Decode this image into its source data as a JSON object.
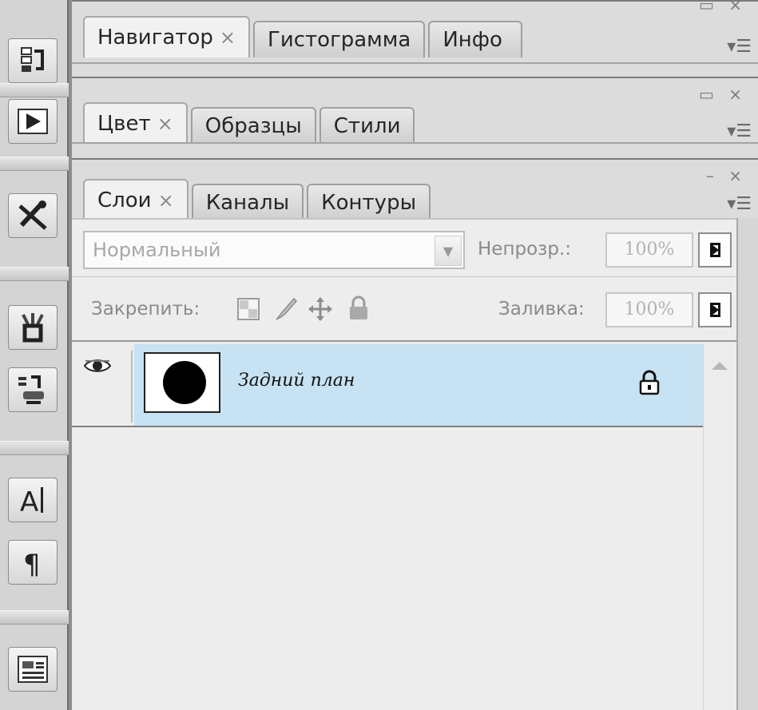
{
  "toolbar": {
    "buttons": [
      {
        "icon": "history-icon"
      },
      {
        "icon": "actions-play-icon"
      },
      {
        "icon": "tool-presets-icon"
      },
      {
        "icon": "brushes-icon"
      },
      {
        "icon": "clone-source-icon"
      },
      {
        "icon": "character-icon"
      },
      {
        "icon": "paragraph-icon"
      },
      {
        "icon": "layer-comps-icon"
      }
    ]
  },
  "panel_top": {
    "tabs": [
      {
        "label": "Навигатор",
        "close": "×",
        "active": true
      },
      {
        "label": "Гистограмма",
        "active": false
      },
      {
        "label": "Инфо",
        "active": false
      }
    ],
    "controls": "▭ ×"
  },
  "panel_color": {
    "tabs": [
      {
        "label": "Цвет",
        "close": "×",
        "active": true
      },
      {
        "label": "Образцы",
        "active": false
      },
      {
        "label": "Стили",
        "active": false
      }
    ],
    "controls": "▭ ×"
  },
  "panel_layers": {
    "tabs": [
      {
        "label": "Слои",
        "close": "×",
        "active": true
      },
      {
        "label": "Каналы",
        "active": false
      },
      {
        "label": "Контуры",
        "active": false
      }
    ],
    "controls": "– ×",
    "menu_icon": "▾☰",
    "blend_mode": "Нормальный",
    "opacity_label": "Непрозр.:",
    "opacity_value": "100%",
    "lock_label": "Закрепить:",
    "fill_label": "Заливка:",
    "fill_value": "100%",
    "layers": [
      {
        "name": "Задний план",
        "visible": true,
        "locked": true,
        "selected": true
      }
    ]
  },
  "colors": {
    "selected_row": "#c7e2f2",
    "panel_bg": "#ededed"
  }
}
